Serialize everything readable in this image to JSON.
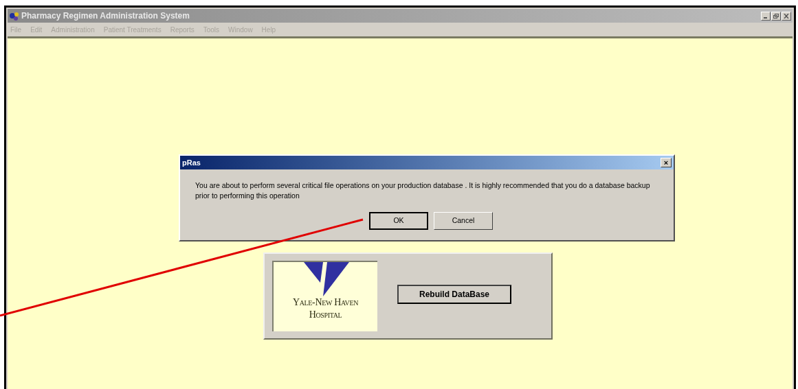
{
  "window": {
    "title": "Pharmacy Regimen Administration System"
  },
  "menu": [
    "File",
    "Edit",
    "Administration",
    "Patient Treatments",
    "Reports",
    "Tools",
    "Window",
    "Help"
  ],
  "dialog": {
    "title": "pRas",
    "close": "×",
    "message": "You are about to perform several critical file operations on your production database . It is highly recommended that you do a database backup prior to performing this operation",
    "buttons": [
      {
        "label": "OK",
        "selected": true
      },
      {
        "label": "Cancel",
        "selected": false
      }
    ]
  },
  "panel": {
    "logo_lines": [
      "Yale-New Haven",
      "Hospital"
    ],
    "button": "Rebuild DataBase"
  }
}
